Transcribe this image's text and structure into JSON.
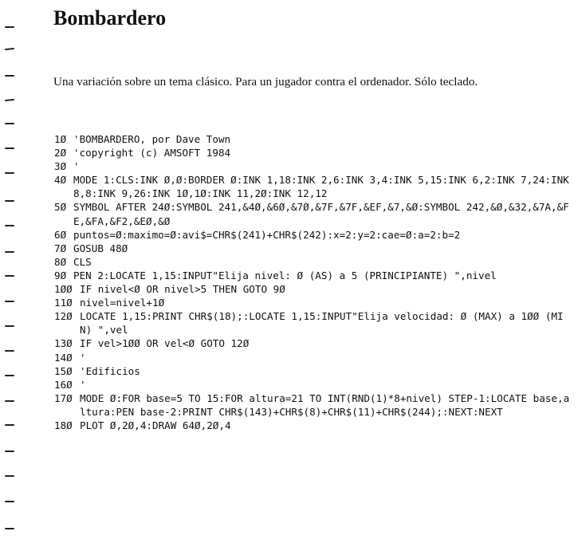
{
  "title": "Bombardero",
  "intro": "Una variación sobre un tema clásico. Para un jugador contra el ordenador. Sólo teclado.",
  "listing": [
    {
      "num": "1Ø",
      "code": "'BOMBARDERO, por Dave Town"
    },
    {
      "num": "2Ø",
      "code": "'copyright (c) AMSOFT 1984"
    },
    {
      "num": "3Ø",
      "code": "'"
    },
    {
      "num": "4Ø",
      "code": "MODE 1:CLS:INK Ø,Ø:BORDER Ø:INK 1,18:INK 2,6:INK 3,4:INK 5,15:INK 6,2:INK 7,24:INK 8,8:INK 9,26:INK 1Ø,1Ø:INK 11,2Ø:INK 12,12"
    },
    {
      "num": "5Ø",
      "code": "SYMBOL AFTER 24Ø:SYMBOL 241,&4Ø,&6Ø,&7Ø,&7F,&7F,&EF,&7,&Ø:SYMBOL 242,&Ø,&32,&7A,&FE,&FA,&F2,&EØ,&Ø"
    },
    {
      "num": "6Ø",
      "code": "puntos=Ø:maximo=Ø:avi$=CHR$(241)+CHR$(242):x=2:y=2:cae=Ø:a=2:b=2"
    },
    {
      "num": "7Ø",
      "code": "GOSUB 48Ø"
    },
    {
      "num": "8Ø",
      "code": "CLS"
    },
    {
      "num": "9Ø",
      "code": "PEN 2:LOCATE 1,15:INPUT\"Elija nivel: Ø (AS) a 5 (PRINCIPIANTE) \",nivel"
    },
    {
      "num": "1ØØ",
      "code": "IF nivel<Ø OR nivel>5 THEN GOTO 9Ø"
    },
    {
      "num": "11Ø",
      "code": "nivel=nivel+1Ø"
    },
    {
      "num": "12Ø",
      "code": "LOCATE 1,15:PRINT CHR$(18);:LOCATE 1,15:INPUT\"Elija velocidad: Ø (MAX) a 1ØØ (MIN) \",vel"
    },
    {
      "num": "13Ø",
      "code": "IF vel>1ØØ OR vel<Ø GOTO 12Ø"
    },
    {
      "num": "14Ø",
      "code": "'"
    },
    {
      "num": "15Ø",
      "code": "'Edificios"
    },
    {
      "num": "16Ø",
      "code": "'"
    },
    {
      "num": "17Ø",
      "code": "MODE Ø:FOR base=5 TO 15:FOR altura=21 TO INT(RND(1)*8+nivel) STEP-1:LOCATE base,altura:PEN base-2:PRINT CHR$(143)+CHR$(8)+CHR$(11)+CHR$(244);:NEXT:NEXT"
    },
    {
      "num": "18Ø",
      "code": "PLOT Ø,2Ø,4:DRAW 64Ø,2Ø,4"
    }
  ]
}
